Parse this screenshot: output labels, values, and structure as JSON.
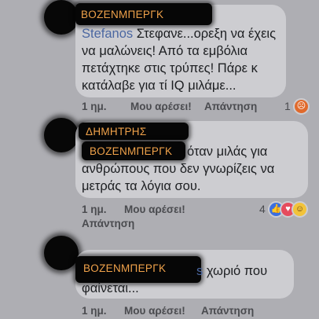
{
  "comments": [
    {
      "author": "BOZENΜΠΕΡΓΚ",
      "mention": "Stefanos",
      "lines": [
        "Στεφανε...ορεξη να έχεις",
        "να μαλώνεις! Από τα εμβόλια",
        "πετάχτηκε στις τρύπες! Πάρε κ",
        "κατάλαβε για τί IQ μιλάμε..."
      ],
      "time": "1 ημ.",
      "like": "Μου αρέσει!",
      "reply": "Απάντηση",
      "reaction_count": "1",
      "reactions": [
        "angry-reaction-icon"
      ]
    },
    {
      "author": "ΔΗΜΗΤΡΗΣ",
      "mention_redacted": "BOZENΜΠΕΡΓΚ",
      "lines": [
        "όταν μιλάς για",
        "ανθρώπους που δεν γνωρίζεις να",
        "μετράς τα λόγια σου."
      ],
      "time": "1 ημ.",
      "like": "Μου αρέσει!",
      "reply": "Απάντηση",
      "reaction_count": "4",
      "reactions": [
        "like-reaction-icon",
        "love-reaction-icon",
        "haha-reaction-icon"
      ]
    },
    {
      "author": "BOZENΜΠΕΡΓΚ",
      "mention_tail": "s",
      "lines": [
        "χωριό που",
        "φαίνεται..."
      ],
      "time": "1 ημ.",
      "like": "Μου αρέσει!",
      "reply": "Απάντηση"
    }
  ],
  "colors": {
    "background": "#aeaeb3",
    "bubble": "#cdcdd1",
    "mention": "#4b67a1",
    "redact_label": "#f0a24a"
  }
}
